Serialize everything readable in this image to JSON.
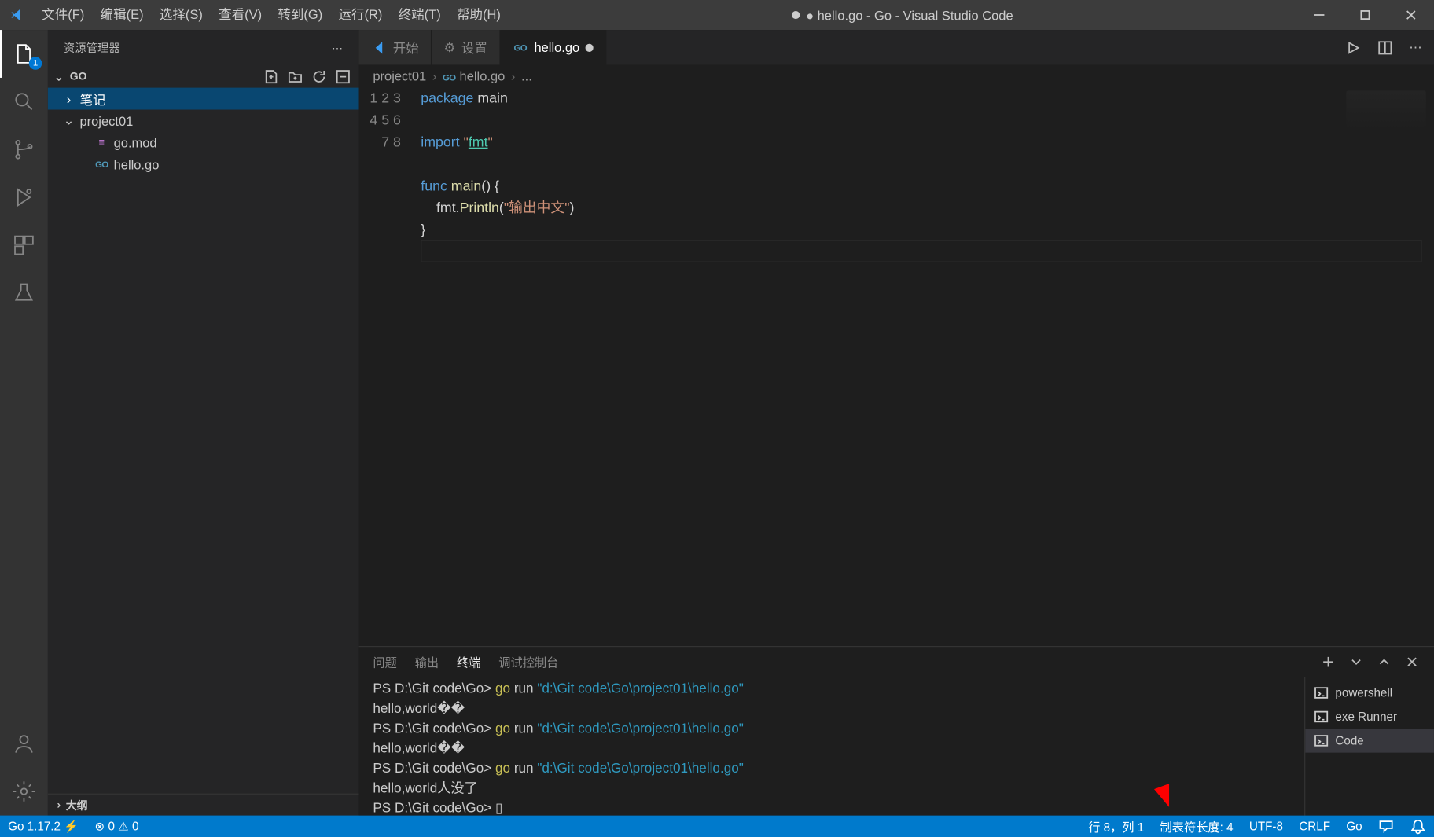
{
  "titlebar": {
    "title_prefix": "● hello.go - Go - Visual Studio Code",
    "menus": [
      "文件(F)",
      "编辑(E)",
      "选择(S)",
      "查看(V)",
      "转到(G)",
      "运行(R)",
      "终端(T)",
      "帮助(H)"
    ]
  },
  "activitybar": {
    "explorer_badge": "1"
  },
  "sidebar": {
    "title": "资源管理器",
    "folder": "GO",
    "tree": [
      {
        "label": "笔记",
        "type": "folder",
        "depth": 1,
        "expanded": false,
        "selected": true
      },
      {
        "label": "project01",
        "type": "folder",
        "depth": 1,
        "expanded": true,
        "selected": false
      },
      {
        "label": "go.mod",
        "type": "file",
        "depth": 2,
        "icon": "mod",
        "selected": false
      },
      {
        "label": "hello.go",
        "type": "file",
        "depth": 2,
        "icon": "go",
        "selected": false
      }
    ],
    "outline_label": "大纲"
  },
  "tabs": [
    {
      "label": "开始",
      "icon": "vscode",
      "active": false,
      "dirty": false
    },
    {
      "label": "设置",
      "icon": "gear",
      "active": false,
      "dirty": false
    },
    {
      "label": "hello.go",
      "icon": "go",
      "active": true,
      "dirty": true
    }
  ],
  "breadcrumbs": [
    "project01",
    "hello.go",
    "..."
  ],
  "code_lines": [
    [
      [
        "kw",
        "package "
      ],
      [
        "pl",
        "main"
      ]
    ],
    [],
    [
      [
        "kw",
        "import "
      ],
      [
        "str",
        "\""
      ],
      [
        "pkg und",
        "fmt"
      ],
      [
        "str",
        "\""
      ]
    ],
    [],
    [
      [
        "kw",
        "func "
      ],
      [
        "id",
        "main"
      ],
      [
        "pl",
        "() {"
      ]
    ],
    [
      [
        "pl",
        "    fmt."
      ],
      [
        "id",
        "Println"
      ],
      [
        "pl",
        "("
      ],
      [
        "str",
        "\"输出中文\""
      ],
      [
        "pl",
        ")"
      ]
    ],
    [
      [
        "pl",
        "}"
      ]
    ],
    []
  ],
  "panel": {
    "tabs": [
      "问题",
      "输出",
      "终端",
      "调试控制台"
    ],
    "active_tab": 2,
    "terminal_lines": [
      [
        [
          "pl",
          "PS D:\\Git code\\Go> "
        ],
        [
          "cmd",
          "go "
        ],
        [
          "pl",
          "run "
        ],
        [
          "path",
          "\"d:\\Git code\\Go\\project01\\hello.go\""
        ]
      ],
      [
        [
          "pl",
          "hello,world��"
        ]
      ],
      [
        [
          "pl",
          "PS D:\\Git code\\Go> "
        ],
        [
          "cmd",
          "go "
        ],
        [
          "pl",
          "run "
        ],
        [
          "path",
          "\"d:\\Git code\\Go\\project01\\hello.go\""
        ]
      ],
      [
        [
          "pl",
          "hello,world��"
        ]
      ],
      [
        [
          "pl",
          "PS D:\\Git code\\Go> "
        ],
        [
          "cmd",
          "go "
        ],
        [
          "pl",
          "run "
        ],
        [
          "path",
          "\"d:\\Git code\\Go\\project01\\hello.go\""
        ]
      ],
      [
        [
          "pl",
          "hello,world人没了"
        ]
      ],
      [
        [
          "pl",
          "PS D:\\Git code\\Go> "
        ],
        [
          "pl",
          "▯"
        ]
      ]
    ],
    "terminals": [
      "powershell",
      "exe Runner",
      "Code"
    ],
    "active_terminal": 2
  },
  "status": {
    "left": [
      "Go 1.17.2 ⚡",
      "⊗ 0 ⚠ 0"
    ],
    "right": [
      "行 8，列 1",
      "制表符长度: 4",
      "UTF-8",
      "CRLF",
      "Go"
    ]
  }
}
